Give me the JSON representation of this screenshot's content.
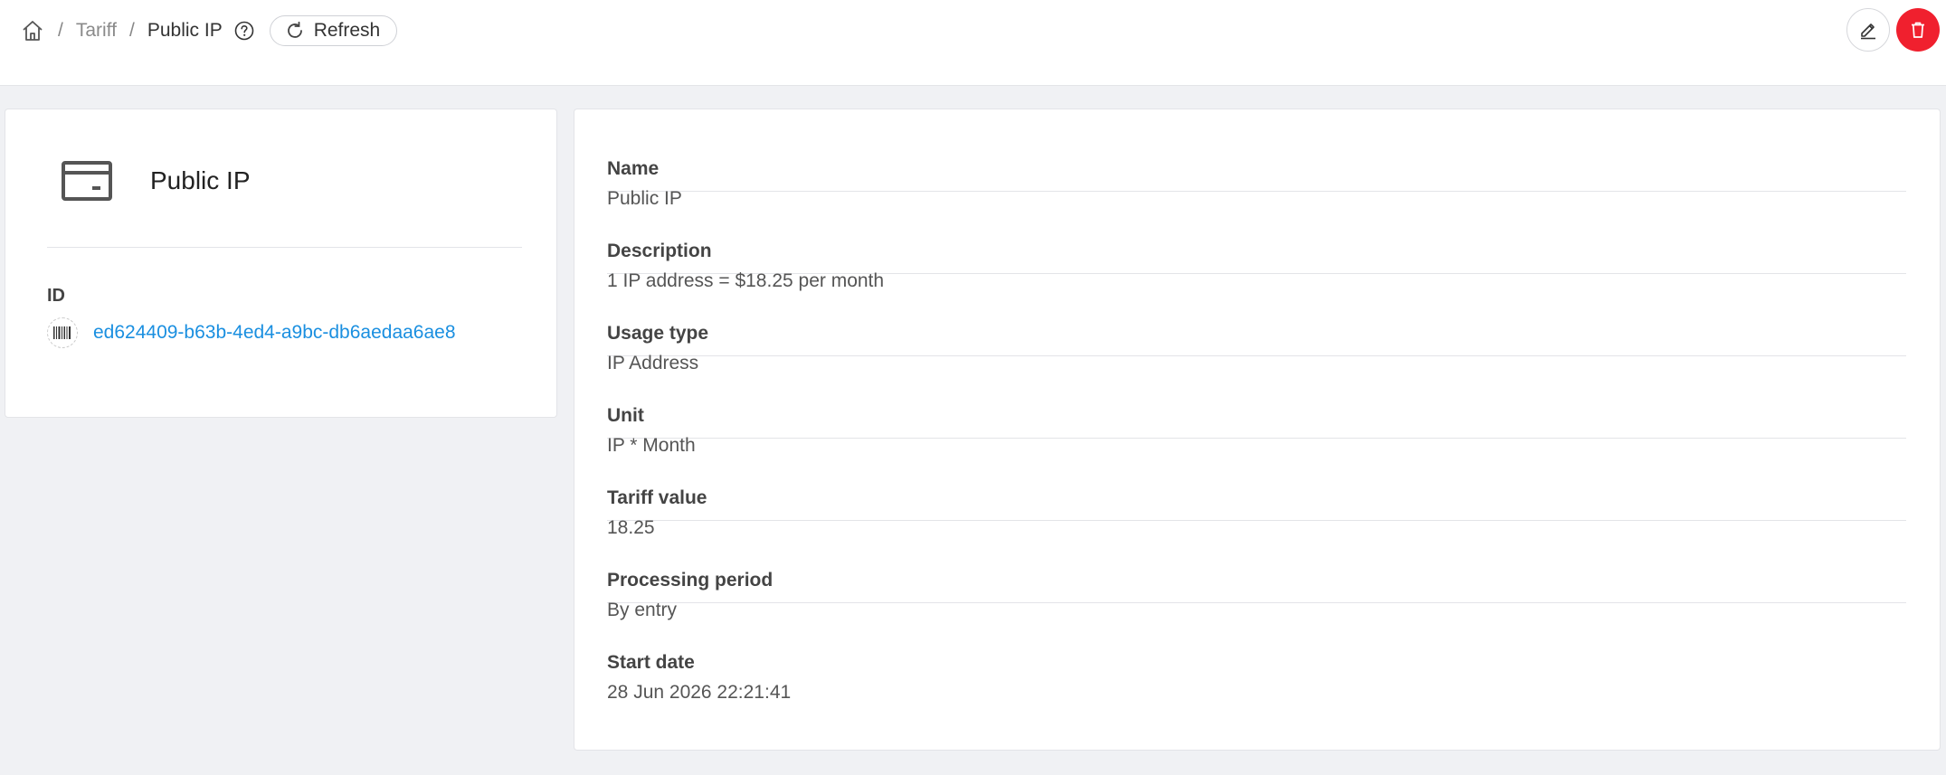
{
  "breadcrumb": {
    "home_icon": "home-icon",
    "separator": "/",
    "parent": "Tariff",
    "current": "Public IP",
    "help_icon": "question-circle-icon"
  },
  "toolbar": {
    "refresh_label": "Refresh",
    "refresh_icon": "refresh-icon",
    "edit_icon": "pencil-icon",
    "delete_icon": "trash-icon",
    "delete_color": "#f0202e"
  },
  "summary": {
    "icon": "credit-card-icon",
    "title": "Public IP",
    "id_label": "ID",
    "id_icon": "barcode-icon",
    "id_value": "ed624409-b63b-4ed4-a9bc-db6aedaa6ae8",
    "link_color": "#1a8fe0"
  },
  "details": {
    "name_label": "Name",
    "name_value": "Public IP",
    "description_label": "Description",
    "description_value": "1 IP address = $18.25 per month",
    "usage_type_label": "Usage type",
    "usage_type_value": "IP Address",
    "unit_label": "Unit",
    "unit_value": "IP * Month",
    "tariff_value_label": "Tariff value",
    "tariff_value_value": "18.25",
    "processing_period_label": "Processing period",
    "processing_period_value": "By entry",
    "start_date_label": "Start date",
    "start_date_value": "28 Jun 2026 22:21:41"
  }
}
